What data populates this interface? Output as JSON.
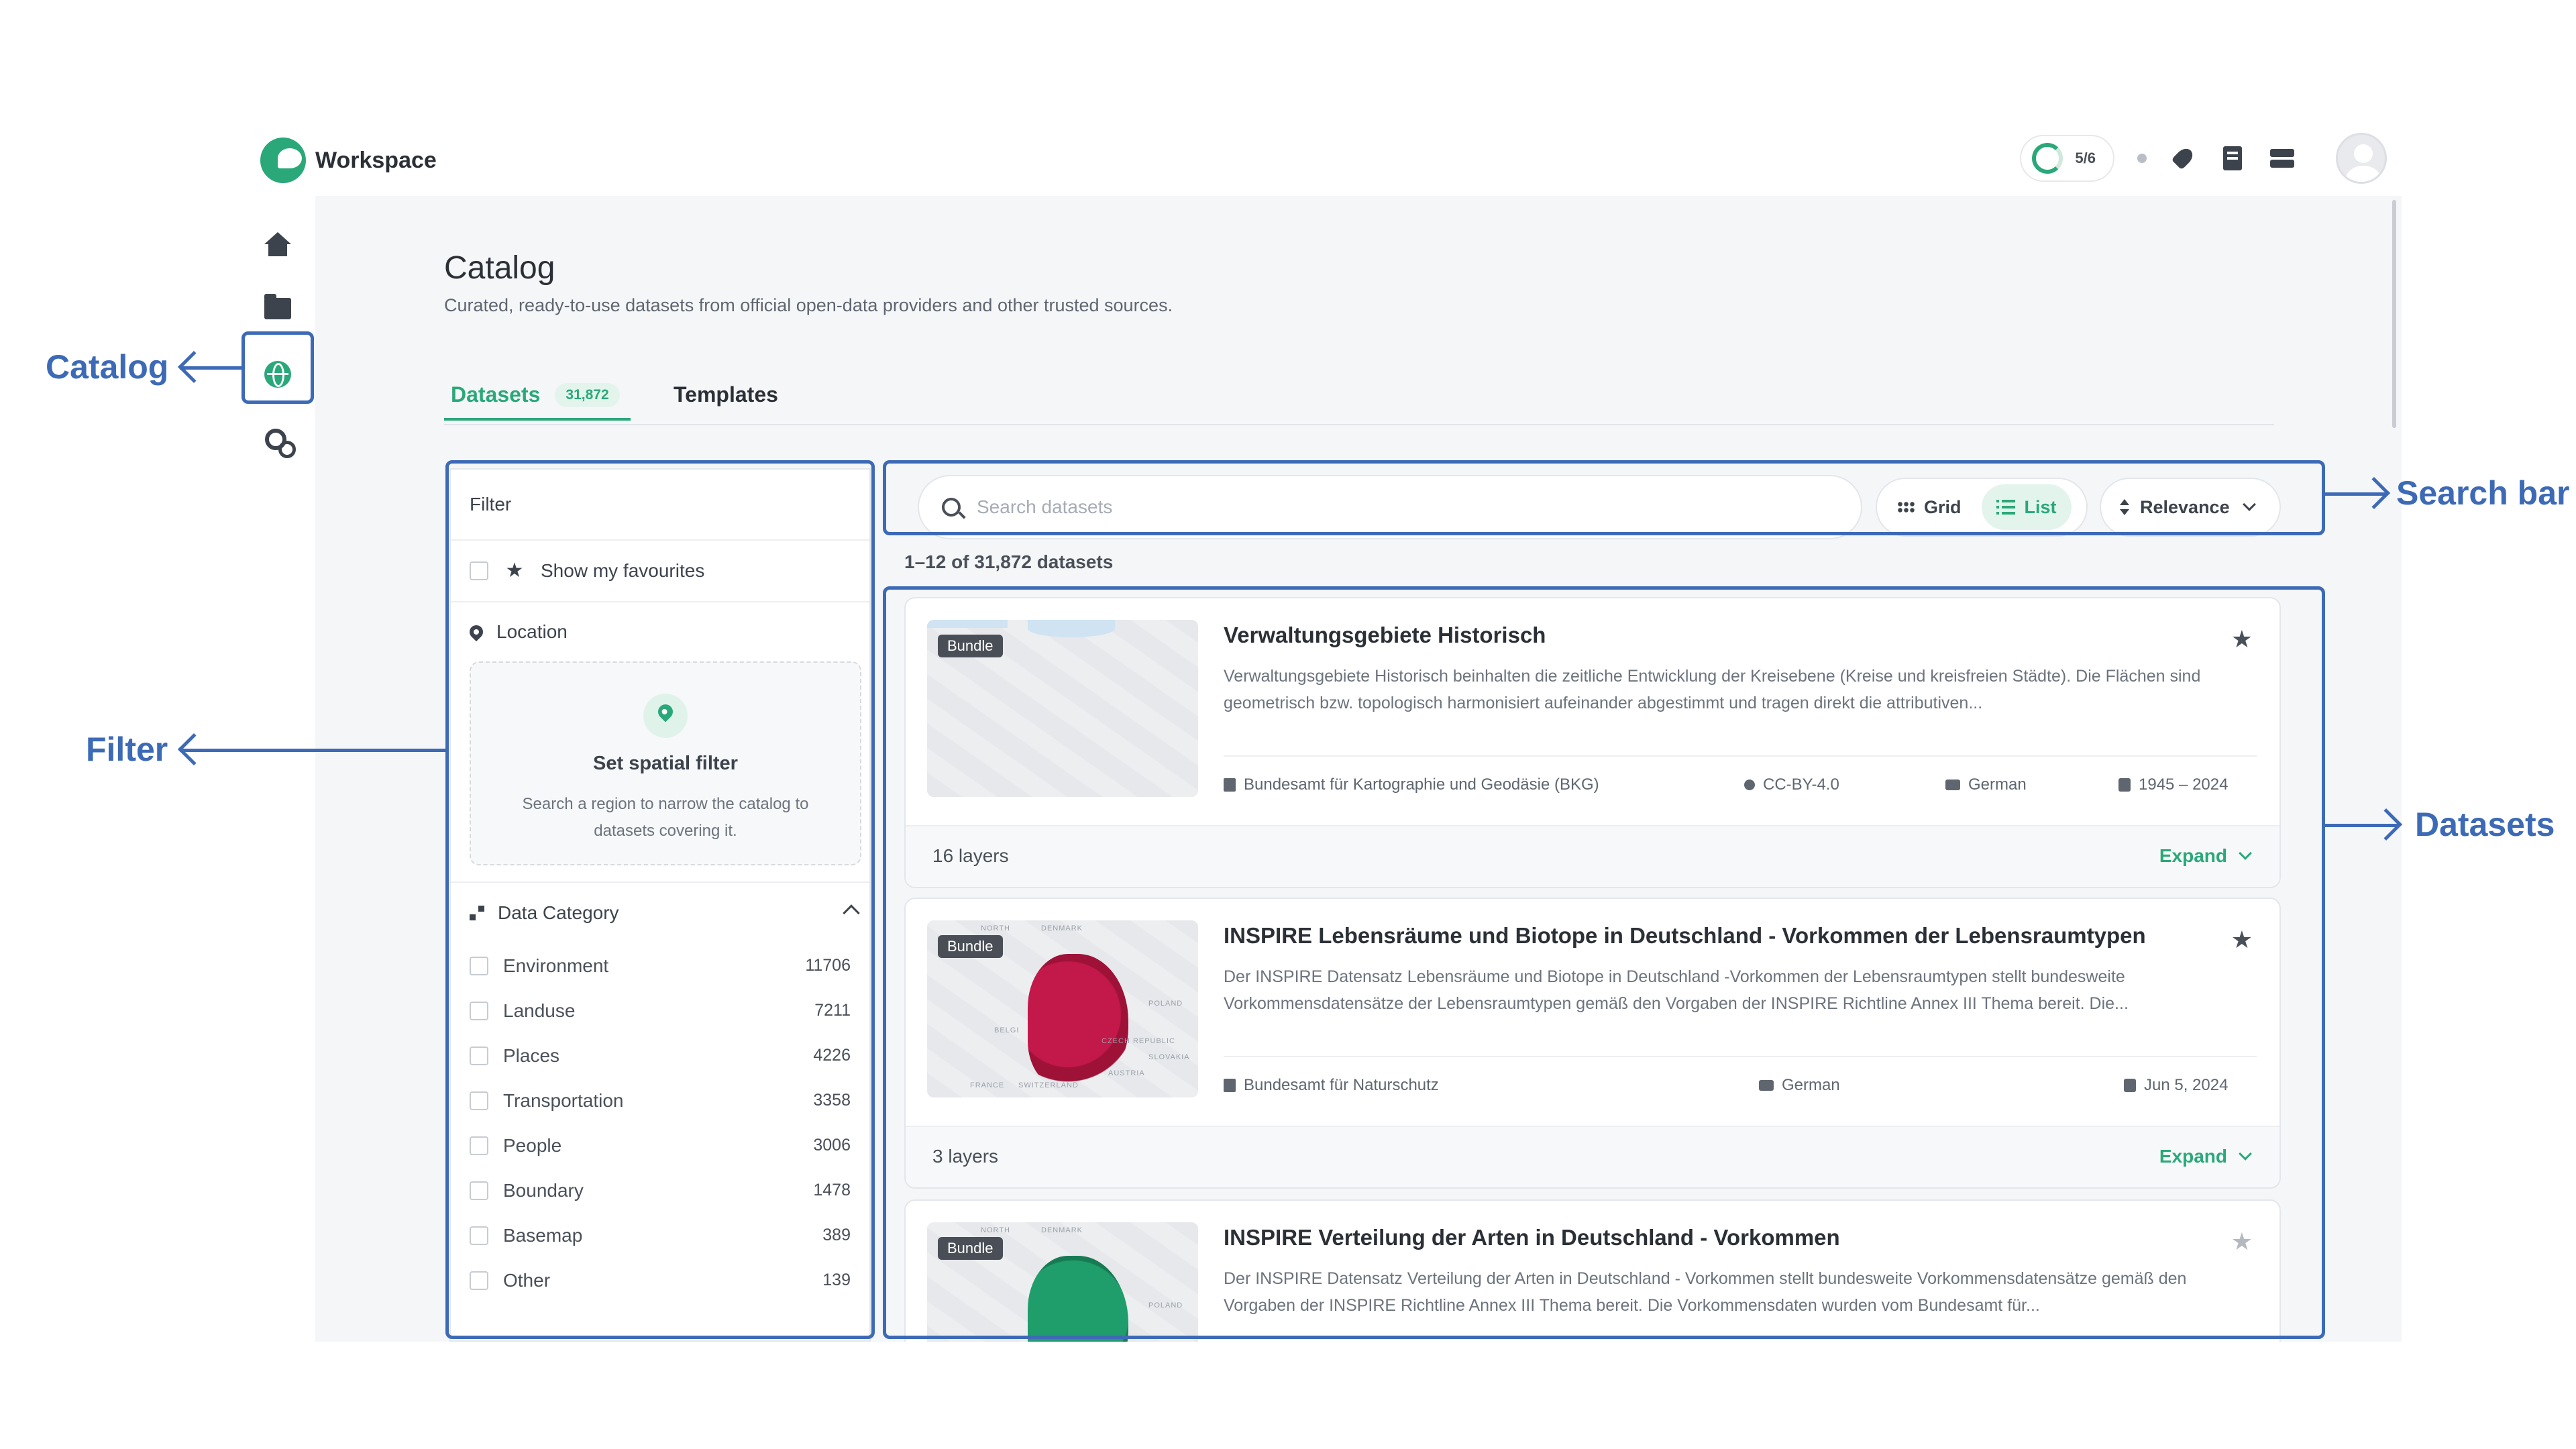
{
  "app": {
    "name": "Workspace"
  },
  "header": {
    "progress_text": "5/6"
  },
  "sidebar": {
    "items": [
      {
        "name": "home"
      },
      {
        "name": "folder"
      },
      {
        "name": "catalog",
        "active": true
      },
      {
        "name": "settings"
      }
    ]
  },
  "page": {
    "title": "Catalog",
    "subtitle": "Curated, ready-to-use datasets from official open-data providers and other trusted sources."
  },
  "tabs": [
    {
      "label": "Datasets",
      "badge": "31,872",
      "active": true
    },
    {
      "label": "Templates"
    }
  ],
  "filter": {
    "title": "Filter",
    "favourites_label": "Show my favourites",
    "location_label": "Location",
    "spatial_title": "Set spatial filter",
    "spatial_desc": "Search a region to narrow the catalog to datasets covering it.",
    "category_label": "Data Category",
    "categories": [
      {
        "label": "Environment",
        "count": "11706"
      },
      {
        "label": "Landuse",
        "count": "7211"
      },
      {
        "label": "Places",
        "count": "4226"
      },
      {
        "label": "Transportation",
        "count": "3358"
      },
      {
        "label": "People",
        "count": "3006"
      },
      {
        "label": "Boundary",
        "count": "1478"
      },
      {
        "label": "Basemap",
        "count": "389"
      },
      {
        "label": "Other",
        "count": "139"
      }
    ]
  },
  "search": {
    "placeholder": "Search datasets"
  },
  "view": {
    "grid_label": "Grid",
    "list_label": "List",
    "active": "List"
  },
  "sort": {
    "label": "Relevance"
  },
  "results": {
    "count_text": "1–12 of 31,872 datasets"
  },
  "datasets": [
    {
      "badge": "Bundle",
      "title": "Verwaltungsgebiete Historisch",
      "description": "Verwaltungsgebiete Historisch beinhalten die zeitliche Entwicklung der Kreisebene (Kreise und kreisfreien Städte). Die Flächen sind geometrisch bzw. topologisch harmonisiert aufeinander abgestimmt und tragen direkt die attributiven...",
      "provider": "Bundesamt für Kartographie und Geodäsie (BKG)",
      "license": "CC-BY-4.0",
      "language": "German",
      "date": "1945 – 2024",
      "layers": "16 layers",
      "expand": "Expand",
      "map_color": "#e9ebee"
    },
    {
      "badge": "Bundle",
      "title": "INSPIRE Lebensräume und Biotope in Deutschland - Vorkommen der Lebensraumtypen",
      "description": "Der INSPIRE Datensatz Lebensräume und Biotope in Deutschland -Vorkommen der Lebensraumtypen stellt bundesweite Vorkommensdatensätze der Lebensraumtypen gemäß den Vorgaben der INSPIRE Richtline Annex III Thema bereit. Die...",
      "provider": "Bundesamt für Naturschutz",
      "language": "German",
      "date": "Jun 5, 2024",
      "layers": "3 layers",
      "expand": "Expand",
      "map_color": "#c2184a",
      "map_labels": [
        "NORTH",
        "DENMARK",
        "POLAND",
        "BELGI",
        "CZECH REPUBLIC",
        "SLOVAKIA",
        "AUSTRIA",
        "FRANCE",
        "SWITZERLAND"
      ]
    },
    {
      "badge": "Bundle",
      "title": "INSPIRE Verteilung der Arten in Deutschland - Vorkommen",
      "description": "Der INSPIRE Datensatz Verteilung der Arten in Deutschland - Vorkommen stellt bundesweite Vorkommensdatensätze gemäß den Vorgaben der INSPIRE Richtline Annex III Thema bereit. Die Vorkommensdaten wurden vom Bundesamt für...",
      "map_color": "#1f9d6a",
      "map_labels": [
        "NORTH",
        "DENMARK",
        "POLAND"
      ]
    }
  ],
  "annotations": {
    "catalog": "Catalog",
    "filter": "Filter",
    "search_bar": "Search bar",
    "datasets": "Datasets",
    "color": "#3d6ab6"
  }
}
